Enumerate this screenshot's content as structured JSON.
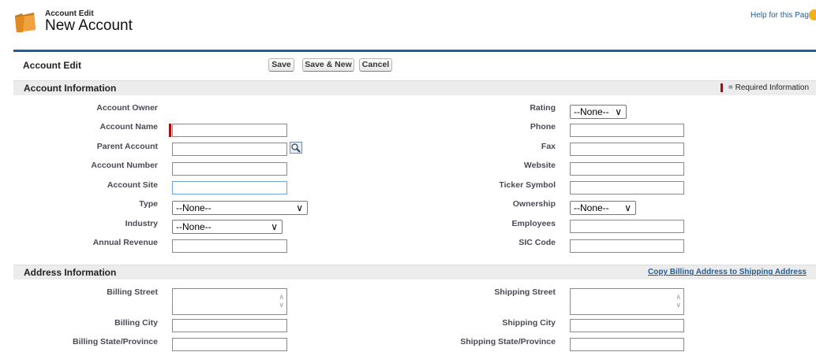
{
  "header": {
    "subtitle": "Account Edit",
    "title": "New Account",
    "help_link": "Help for this Page"
  },
  "toolbar": {
    "title": "Account Edit",
    "save": "Save",
    "save_new": "Save & New",
    "cancel": "Cancel"
  },
  "account_info": {
    "section_title": "Account Information",
    "required_legend": "= Required Information",
    "left": {
      "owner": "Account Owner",
      "name": "Account Name",
      "parent": "Parent Account",
      "number": "Account Number",
      "site": "Account Site",
      "type": "Type",
      "industry": "Industry",
      "revenue": "Annual Revenue"
    },
    "right": {
      "rating": "Rating",
      "phone": "Phone",
      "fax": "Fax",
      "website": "Website",
      "ticker": "Ticker Symbol",
      "ownership": "Ownership",
      "employees": "Employees",
      "sic": "SIC Code"
    },
    "select_none": "--None--"
  },
  "address_info": {
    "section_title": "Address Information",
    "copy_link": "Copy Billing Address to Shipping Address",
    "billing_street": "Billing Street",
    "billing_city": "Billing City",
    "billing_state": "Billing State/Province",
    "shipping_street": "Shipping Street",
    "shipping_city": "Shipping City",
    "shipping_state": "Shipping State/Province"
  },
  "colors": {
    "accent_blue": "#1f5d99",
    "required_red": "#c00000",
    "divider_blue": "#1f5d99"
  }
}
